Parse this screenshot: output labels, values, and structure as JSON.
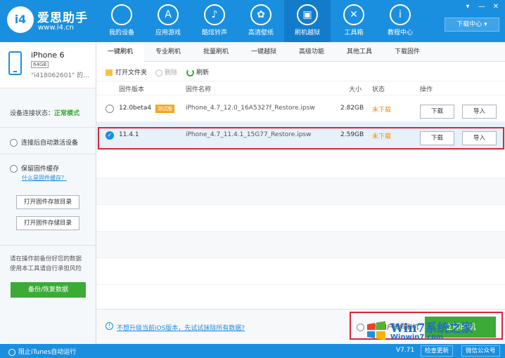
{
  "brand": {
    "name": "爱思助手",
    "url": "www.i4.cn",
    "badge": "i4"
  },
  "nav": [
    {
      "label": "我的设备",
      "icon": "apple-icon",
      "glyph": ""
    },
    {
      "label": "应用游戏",
      "icon": "app-store-icon",
      "glyph": "A"
    },
    {
      "label": "酷炫铃声",
      "icon": "bell-icon",
      "glyph": "♪"
    },
    {
      "label": "高清壁纸",
      "icon": "flower-icon",
      "glyph": "✿"
    },
    {
      "label": "刷机越狱",
      "icon": "box-icon",
      "glyph": "▣"
    },
    {
      "label": "工具箱",
      "icon": "tools-icon",
      "glyph": "✕"
    },
    {
      "label": "教程中心",
      "icon": "info-icon",
      "glyph": "i"
    }
  ],
  "header": {
    "download_center": "下载中心 ▾",
    "window_buttons": [
      "▾",
      "—",
      "✕"
    ]
  },
  "device": {
    "name": "iPhone 6",
    "capacity": "64GB",
    "id": "\"i418062601\" 的..."
  },
  "sidebar": {
    "conn_label": "设备连接状态：",
    "conn_value": "正常模式",
    "auto_activate": "连接后自动激活设备",
    "keep_cache": "保留固件缓存",
    "what_is_cache": "什么是固件缓存？",
    "open_cache_dir": "打开固件存放目录",
    "open_storage_dir": "打开固件存储目录",
    "note": "请在操作前备份好您的数据使用本工具请自行承担风险",
    "backup_button": "备份/恢复数据"
  },
  "tabs": [
    "一键刷机",
    "专业刷机",
    "批量刷机",
    "一键越狱",
    "高级功能",
    "其他工具",
    "下载固件"
  ],
  "toolbar": {
    "open_folder": "打开文件夹",
    "delete": "删除",
    "refresh": "刷新"
  },
  "table": {
    "headers": {
      "version": "固件版本",
      "name": "固件名称",
      "size": "大小",
      "status": "状态",
      "action": "操作"
    },
    "rows": [
      {
        "version": "12.0beta4",
        "badge": "测试版",
        "name": "iPhone_4.7_12.0_16A5327f_Restore.ipsw",
        "size": "2.82GB",
        "status": "未下载",
        "download": "下载",
        "import": "导入",
        "selected": false
      },
      {
        "version": "11.4.1",
        "badge": "",
        "name": "iPhone_4.7_11.4.1_15G77_Restore.ipsw",
        "size": "2.59GB",
        "status": "未下载",
        "download": "下载",
        "import": "导入",
        "selected": true
      }
    ]
  },
  "footer": {
    "link": "不想升级当前iOS版本，先试试抹除所有数据?",
    "keep_data": "保留用户资料刷机",
    "flash_button": "立即刷机"
  },
  "statusbar": {
    "block_itunes": "阻止iTunes自动运行",
    "version": "V7.71",
    "check_update": "检查更新",
    "wechat": "微信公众号"
  },
  "watermark": {
    "text": "Win7系统之家",
    "url": "Winwin7.com"
  },
  "colors": {
    "brand_blue": "#1a8fdf",
    "green": "#3caa36",
    "orange": "#f08c00",
    "highlight_red": "#d9263a"
  }
}
